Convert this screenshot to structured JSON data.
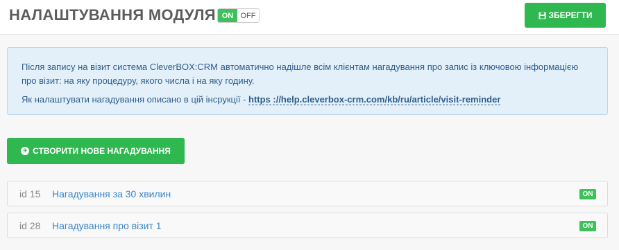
{
  "header": {
    "title": "НАЛАШТУВАННЯ МОДУЛЯ",
    "toggle_on": "ON",
    "toggle_off": "OFF",
    "save_label": "ЗБЕРЕГТИ"
  },
  "info": {
    "text1": "Після запису на візит система CleverBOX:CRM автоматично надішле всім клієнтам нагадування про запис із ключовою інформацією про візит: на яку процедуру, якого числа і на яку годину.",
    "text2": "Як налаштувати нагадування описано в цій інсрукції - ",
    "link": "https ://help.cleverbox-crm.com/kb/ru/article/visit-reminder"
  },
  "create_label": "СТВОРИТИ НОВЕ НАГАДУВАННЯ",
  "reminders": [
    {
      "id": "id 15",
      "name": "Нагадування за 30 хвилин",
      "status": "ON"
    },
    {
      "id": "id 28",
      "name": "Нагадування про візит 1",
      "status": "ON"
    }
  ],
  "colors": {
    "accent_green": "#2fb84f",
    "info_bg": "#e3f0fa",
    "link_blue": "#3a86c8"
  }
}
